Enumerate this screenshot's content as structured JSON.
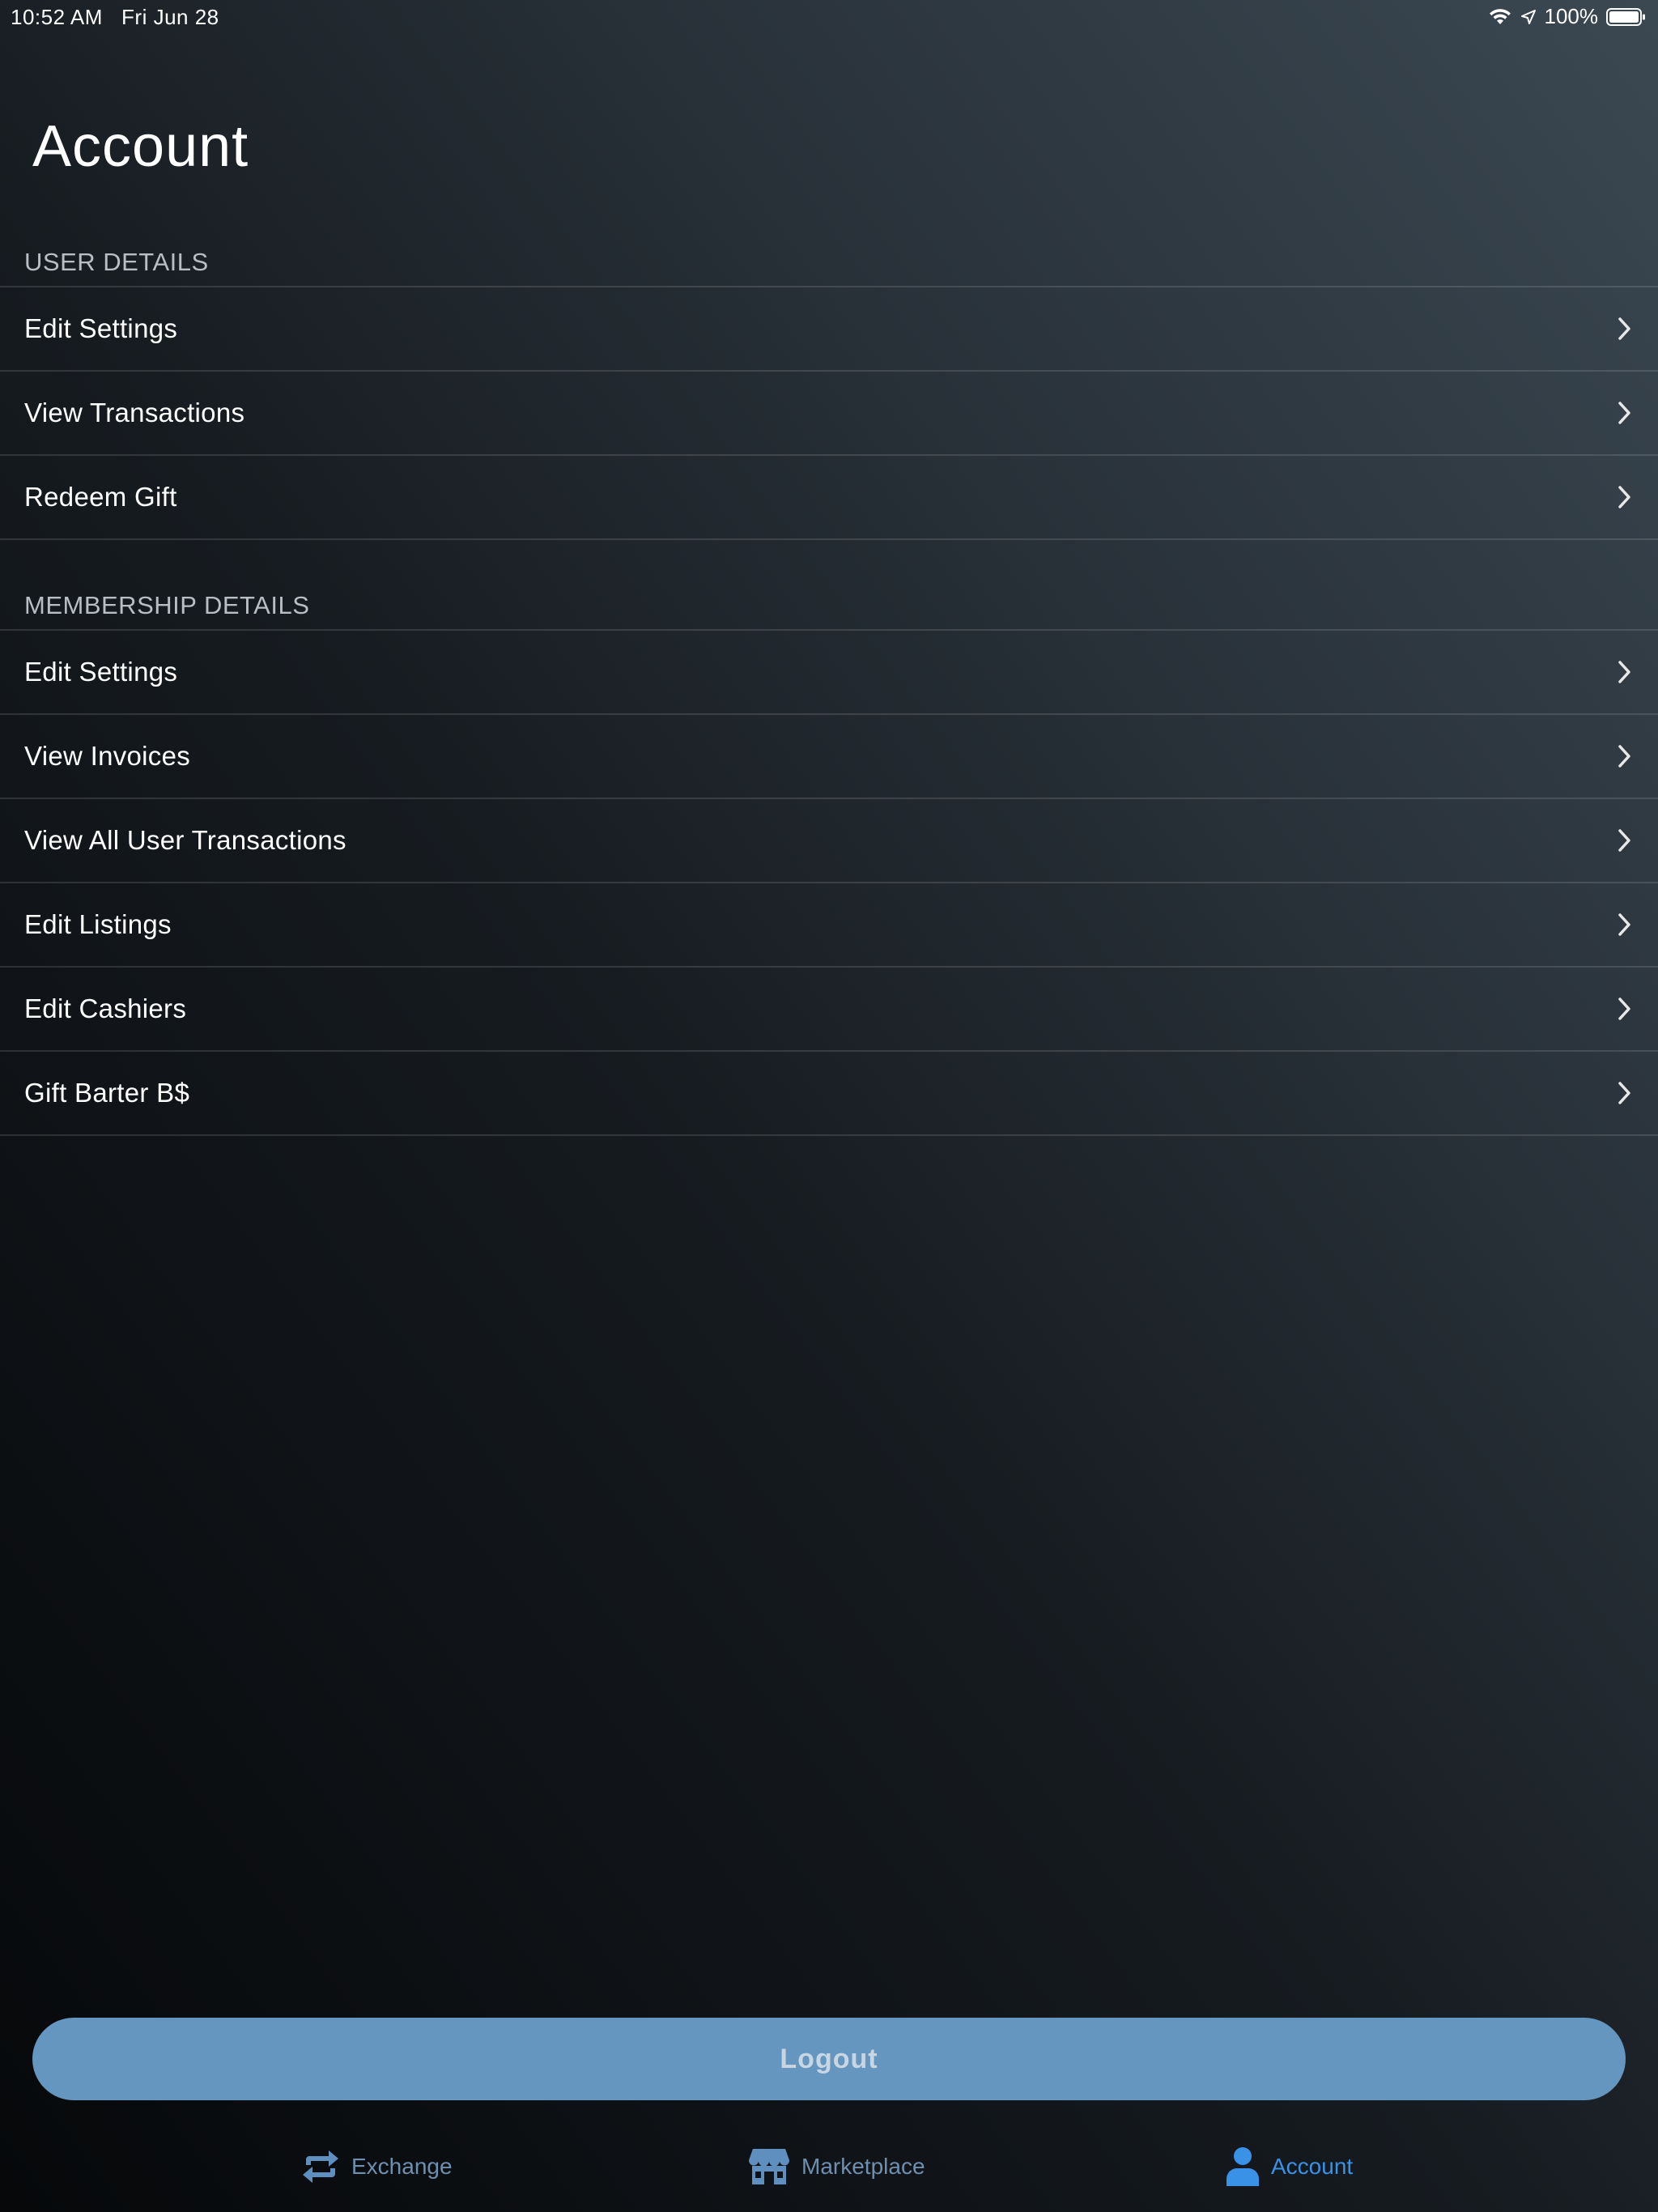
{
  "status_bar": {
    "time": "10:52 AM",
    "date": "Fri Jun 28",
    "battery": "100%"
  },
  "page_title": "Account",
  "sections": [
    {
      "header": "USER DETAILS",
      "items": [
        {
          "label": "Edit Settings"
        },
        {
          "label": "View Transactions"
        },
        {
          "label": "Redeem Gift"
        }
      ]
    },
    {
      "header": "MEMBERSHIP DETAILS",
      "items": [
        {
          "label": "Edit Settings"
        },
        {
          "label": "View Invoices"
        },
        {
          "label": "View All User Transactions"
        },
        {
          "label": "Edit Listings"
        },
        {
          "label": "Edit Cashiers"
        },
        {
          "label": "Gift Barter B$"
        }
      ]
    }
  ],
  "logout_label": "Logout",
  "tabs": [
    {
      "label": "Exchange",
      "icon": "exchange-icon"
    },
    {
      "label": "Marketplace",
      "icon": "store-icon"
    },
    {
      "label": "Account",
      "icon": "person-icon",
      "active": true
    }
  ],
  "colors": {
    "accent": "#3a92e6",
    "button": "#6496bf",
    "inactive_tab": "#6f8fae"
  }
}
